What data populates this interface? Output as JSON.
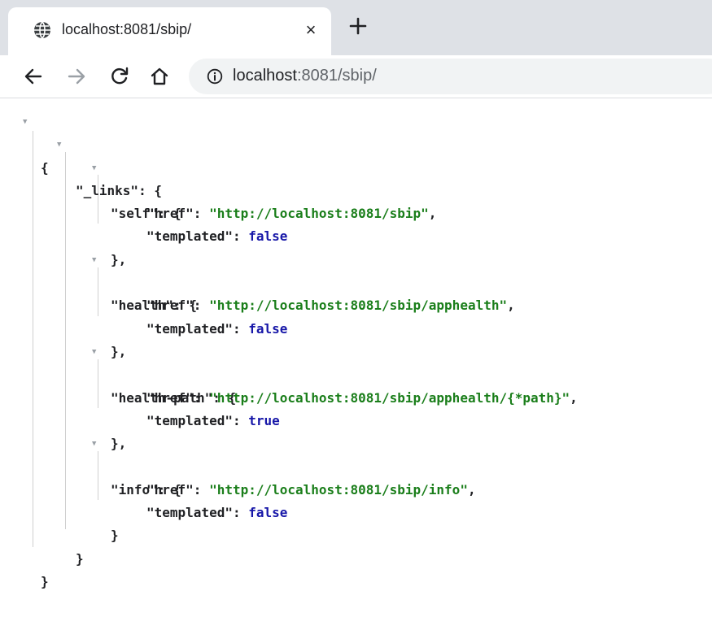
{
  "browser": {
    "tab": {
      "title": "localhost:8081/sbip/",
      "favicon": "globe-icon",
      "close": "×"
    },
    "new_tab": "plus-icon",
    "toolbar": {
      "back": "back-arrow-icon",
      "forward": "forward-arrow-icon",
      "reload": "reload-icon",
      "home": "home-icon",
      "site_info": "info-icon",
      "url_host": "localhost",
      "url_rest": ":8081/sbip/"
    }
  },
  "json": {
    "open_brace": "{",
    "close_brace": "}",
    "links_key": "\"_links\"",
    "entries": [
      {
        "key": "\"self\"",
        "href": "\"http://localhost:8081/sbip\"",
        "templated": "false"
      },
      {
        "key": "\"health\"",
        "href": "\"http://localhost:8081/sbip/apphealth\"",
        "templated": "false"
      },
      {
        "key": "\"health-path\"",
        "href": "\"http://localhost:8081/sbip/apphealth/{*path}\"",
        "templated": "true"
      },
      {
        "key": "\"info\"",
        "href": "\"http://localhost:8081/sbip/info\"",
        "templated": "false"
      }
    ],
    "href_key": "\"href\"",
    "templated_key": "\"templated\"",
    "collapse_glyph": "▼"
  },
  "colors": {
    "string": "#1a7e1a",
    "boolean": "#1717a8",
    "tabstrip": "#dee1e6",
    "omnibox": "#f1f3f4"
  }
}
